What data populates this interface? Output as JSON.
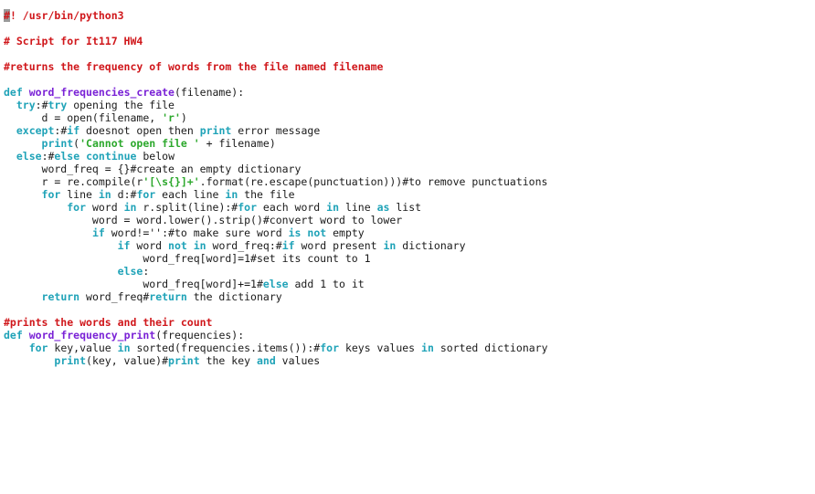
{
  "editor": {
    "colors": {
      "comment": "#d0171b",
      "keyword": "#20a3b8",
      "defname": "#7a22d6",
      "string": "#2ca82c",
      "plain": "#1a1a1a",
      "cursor": "#9a9a9a"
    },
    "cursor": {
      "line": 1,
      "column": 1,
      "char": "#"
    },
    "lines": [
      [
        [
          "cursor",
          "#"
        ],
        [
          "comment",
          "! /usr/bin/python3"
        ]
      ],
      [],
      [
        [
          "comment",
          "# Script for It117 HW4"
        ]
      ],
      [],
      [
        [
          "comment",
          "#returns the frequency of words from the file named filename"
        ]
      ],
      [],
      [
        [
          "keyword",
          "def"
        ],
        [
          "plain",
          " "
        ],
        [
          "defname",
          "word_frequencies_create"
        ],
        [
          "plain",
          "(filename):"
        ]
      ],
      [
        [
          "plain",
          "  "
        ],
        [
          "keyword",
          "try"
        ],
        [
          "plain",
          ":#"
        ],
        [
          "keyword",
          "try"
        ],
        [
          "plain",
          " opening the file"
        ]
      ],
      [
        [
          "plain",
          "      d = open(filename, "
        ],
        [
          "string",
          "'r'"
        ],
        [
          "plain",
          ")"
        ]
      ],
      [
        [
          "plain",
          "  "
        ],
        [
          "keyword",
          "except"
        ],
        [
          "plain",
          ":#"
        ],
        [
          "keyword",
          "if"
        ],
        [
          "plain",
          " doesnot open then "
        ],
        [
          "keyword",
          "print"
        ],
        [
          "plain",
          " error message"
        ]
      ],
      [
        [
          "plain",
          "      "
        ],
        [
          "keyword",
          "print"
        ],
        [
          "plain",
          "("
        ],
        [
          "string",
          "'Cannot open file '"
        ],
        [
          "plain",
          " + filename)"
        ]
      ],
      [
        [
          "plain",
          "  "
        ],
        [
          "keyword",
          "else"
        ],
        [
          "plain",
          ":#"
        ],
        [
          "keyword",
          "else"
        ],
        [
          "plain",
          " "
        ],
        [
          "keyword",
          "continue"
        ],
        [
          "plain",
          " below"
        ]
      ],
      [
        [
          "plain",
          "      word_freq = {}#create an empty dictionary"
        ]
      ],
      [
        [
          "plain",
          "      r = re.compile(r"
        ],
        [
          "string",
          "'[\\s{}]+'"
        ],
        [
          "plain",
          ".format(re.escape(punctuation)))#to remove punctuations"
        ]
      ],
      [
        [
          "plain",
          "      "
        ],
        [
          "keyword",
          "for"
        ],
        [
          "plain",
          " line "
        ],
        [
          "keyword",
          "in"
        ],
        [
          "plain",
          " d:#"
        ],
        [
          "keyword",
          "for"
        ],
        [
          "plain",
          " each line "
        ],
        [
          "keyword",
          "in"
        ],
        [
          "plain",
          " the file"
        ]
      ],
      [
        [
          "plain",
          "          "
        ],
        [
          "keyword",
          "for"
        ],
        [
          "plain",
          " word "
        ],
        [
          "keyword",
          "in"
        ],
        [
          "plain",
          " r.split(line):#"
        ],
        [
          "keyword",
          "for"
        ],
        [
          "plain",
          " each word "
        ],
        [
          "keyword",
          "in"
        ],
        [
          "plain",
          " line "
        ],
        [
          "keyword",
          "as"
        ],
        [
          "plain",
          " list"
        ]
      ],
      [
        [
          "plain",
          "              word = word.lower().strip()#convert word to lower"
        ]
      ],
      [
        [
          "plain",
          "              "
        ],
        [
          "keyword",
          "if"
        ],
        [
          "plain",
          " word!='':#to make sure word "
        ],
        [
          "keyword",
          "is"
        ],
        [
          "plain",
          " "
        ],
        [
          "keyword",
          "not"
        ],
        [
          "plain",
          " empty"
        ]
      ],
      [
        [
          "plain",
          "                  "
        ],
        [
          "keyword",
          "if"
        ],
        [
          "plain",
          " word "
        ],
        [
          "keyword",
          "not"
        ],
        [
          "plain",
          " "
        ],
        [
          "keyword",
          "in"
        ],
        [
          "plain",
          " word_freq:#"
        ],
        [
          "keyword",
          "if"
        ],
        [
          "plain",
          " word present "
        ],
        [
          "keyword",
          "in"
        ],
        [
          "plain",
          " dictionary"
        ]
      ],
      [
        [
          "plain",
          "                      word_freq[word]=1#set its count to 1"
        ]
      ],
      [
        [
          "plain",
          "                  "
        ],
        [
          "keyword",
          "else"
        ],
        [
          "plain",
          ":"
        ]
      ],
      [
        [
          "plain",
          "                      word_freq[word]+=1#"
        ],
        [
          "keyword",
          "else"
        ],
        [
          "plain",
          " add 1 to it"
        ]
      ],
      [
        [
          "plain",
          "      "
        ],
        [
          "keyword",
          "return"
        ],
        [
          "plain",
          " word_freq#"
        ],
        [
          "keyword",
          "return"
        ],
        [
          "plain",
          " the dictionary"
        ]
      ],
      [],
      [
        [
          "comment",
          "#prints the words and their count"
        ]
      ],
      [
        [
          "keyword",
          "def"
        ],
        [
          "plain",
          " "
        ],
        [
          "defname",
          "word_frequency_print"
        ],
        [
          "plain",
          "(frequencies):"
        ]
      ],
      [
        [
          "plain",
          "    "
        ],
        [
          "keyword",
          "for"
        ],
        [
          "plain",
          " key,value "
        ],
        [
          "keyword",
          "in"
        ],
        [
          "plain",
          " sorted(frequencies.items()):#"
        ],
        [
          "keyword",
          "for"
        ],
        [
          "plain",
          " keys values "
        ],
        [
          "keyword",
          "in"
        ],
        [
          "plain",
          " sorted dictionary"
        ]
      ],
      [
        [
          "plain",
          "        "
        ],
        [
          "keyword",
          "print"
        ],
        [
          "plain",
          "(key, value)#"
        ],
        [
          "keyword",
          "print"
        ],
        [
          "plain",
          " the key "
        ],
        [
          "keyword",
          "and"
        ],
        [
          "plain",
          " values"
        ]
      ]
    ]
  }
}
